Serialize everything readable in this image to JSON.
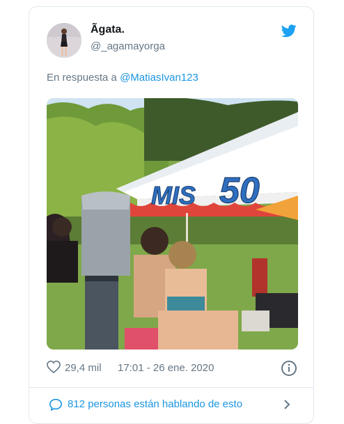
{
  "tweet": {
    "display_name": "Ãgata.",
    "handle": "@_agamayorga",
    "reply_prefix": "En respuesta a ",
    "reply_to": "@MatiasIvan123",
    "likes": "29,4 mil",
    "timestamp": "17:01 - 26 ene. 2020",
    "conversation_text": "812 personas están hablando de esto"
  },
  "photo": {
    "banner_text_1": "MIS",
    "banner_text_2": "50"
  },
  "icons": {
    "twitter": "twitter-bird-icon",
    "like": "heart-icon",
    "info": "info-icon",
    "conversation": "speech-bubble-icon",
    "chevron": "chevron-right-icon"
  },
  "colors": {
    "brand_blue": "#1da1f2",
    "link_blue": "#1b95e0",
    "secondary_text": "#657786"
  }
}
